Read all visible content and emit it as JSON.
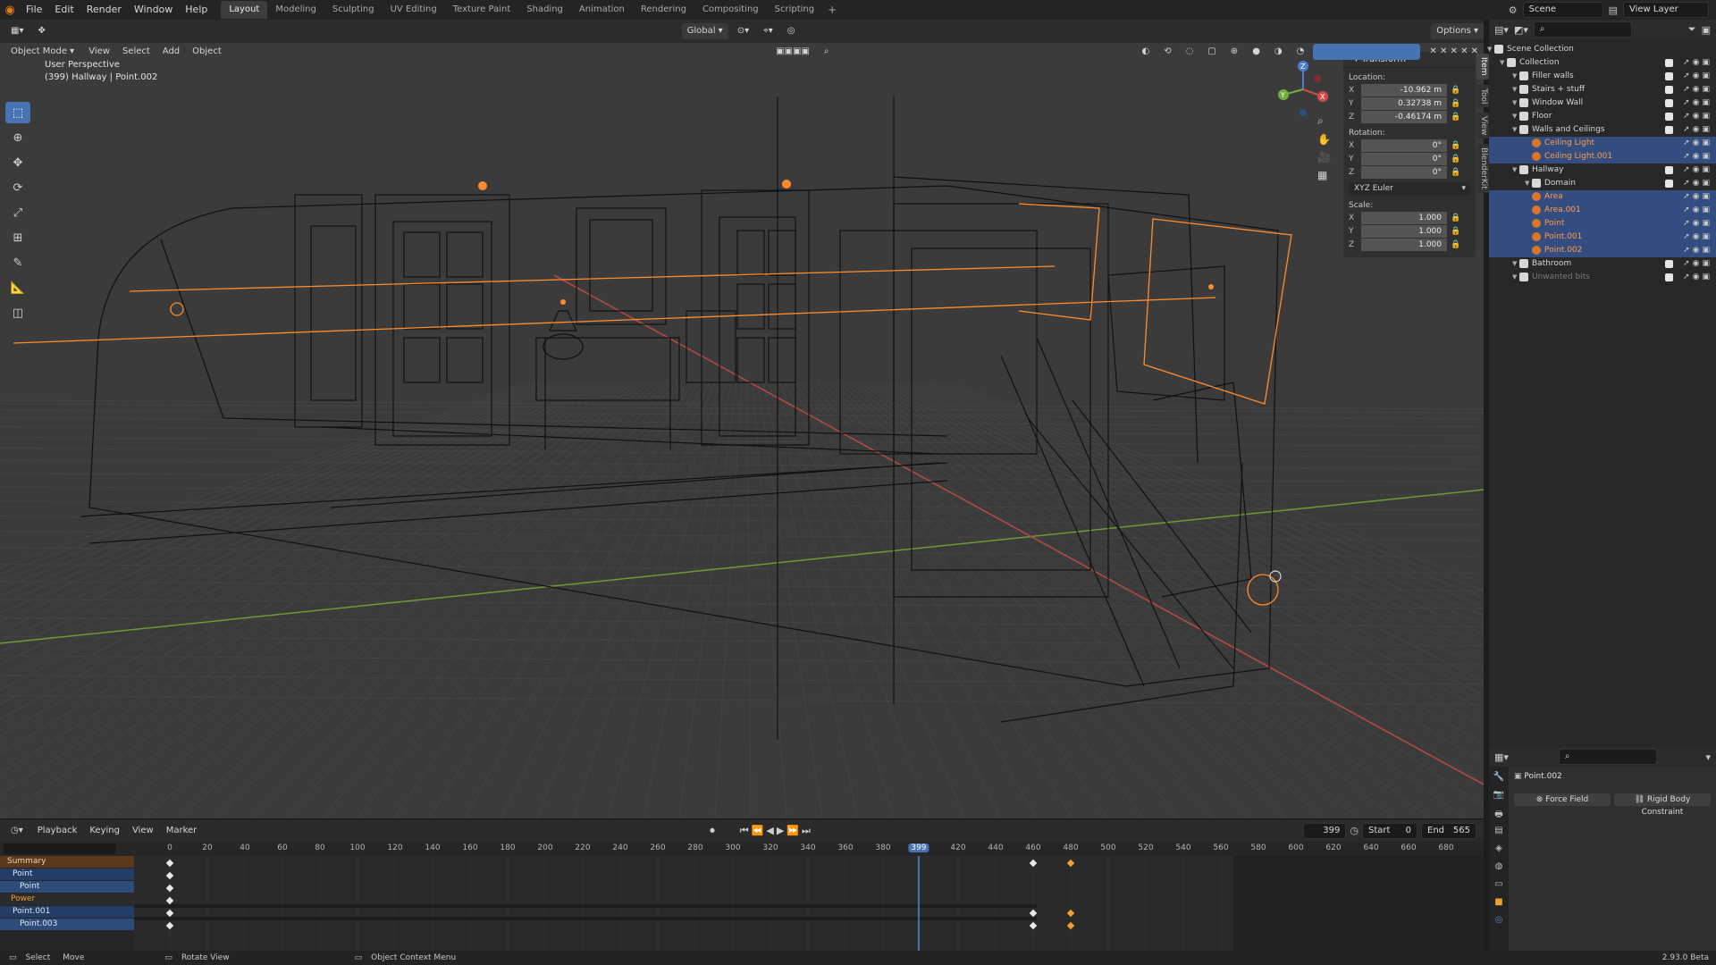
{
  "topbar": {
    "menus": [
      "File",
      "Edit",
      "Render",
      "Window",
      "Help"
    ],
    "workspaces": [
      "Layout",
      "Modeling",
      "Sculpting",
      "UV Editing",
      "Texture Paint",
      "Shading",
      "Animation",
      "Rendering",
      "Compositing",
      "Scripting"
    ],
    "active_workspace": "Layout",
    "add_tab": "+",
    "scene": "Scene",
    "view_layer": "View Layer"
  },
  "viewport": {
    "mode": "Object Mode",
    "menus": [
      "View",
      "Select",
      "Add",
      "Object"
    ],
    "orientation": "Global",
    "options": "Options",
    "perspective": "User Perspective",
    "object_info": "(399) Hallway | Point.002",
    "tools": [
      "select-box",
      "cursor",
      "move",
      "rotate",
      "scale",
      "transform",
      "annotate",
      "measure",
      "add-cube"
    ],
    "gizmo_axes": [
      "X",
      "Y",
      "Z"
    ]
  },
  "npanel": {
    "title": "Transform",
    "location_label": "Location:",
    "location": {
      "x": "-10.962 m",
      "y": "0.32738 m",
      "z": "-0.46174 m"
    },
    "rotation_label": "Rotation:",
    "rotation": {
      "x": "0°",
      "y": "0°",
      "z": "0°"
    },
    "euler_mode": "XYZ Euler",
    "scale_label": "Scale:",
    "scale": {
      "x": "1.000",
      "y": "1.000",
      "z": "1.000"
    },
    "side_tabs": [
      "Item",
      "Tool",
      "View",
      "BlenderKit"
    ]
  },
  "outliner": {
    "rows": [
      {
        "label": "Scene Collection",
        "depth": 0,
        "selected": false,
        "kind": "scene",
        "faded": false
      },
      {
        "label": "Collection",
        "depth": 1,
        "selected": false,
        "kind": "collection",
        "faded": false
      },
      {
        "label": "Filler walls",
        "depth": 2,
        "selected": false,
        "kind": "collection",
        "faded": false
      },
      {
        "label": "Stairs + stuff",
        "depth": 2,
        "selected": false,
        "kind": "collection",
        "faded": false
      },
      {
        "label": "Window Wall",
        "depth": 2,
        "selected": false,
        "kind": "collection",
        "faded": false
      },
      {
        "label": "Floor",
        "depth": 2,
        "selected": false,
        "kind": "collection",
        "faded": false
      },
      {
        "label": "Walls and Ceilings",
        "depth": 2,
        "selected": false,
        "kind": "collection",
        "faded": false
      },
      {
        "label": "Ceiling Light",
        "depth": 3,
        "selected": true,
        "kind": "light",
        "faded": false
      },
      {
        "label": "Ceiling Light.001",
        "depth": 3,
        "selected": true,
        "kind": "light",
        "faded": false
      },
      {
        "label": "Hallway",
        "depth": 2,
        "selected": false,
        "kind": "collection",
        "faded": false
      },
      {
        "label": "Domain",
        "depth": 3,
        "selected": false,
        "kind": "collection",
        "faded": false
      },
      {
        "label": "Area",
        "depth": 3,
        "selected": true,
        "kind": "light",
        "faded": false
      },
      {
        "label": "Area.001",
        "depth": 3,
        "selected": true,
        "kind": "light",
        "faded": false
      },
      {
        "label": "Point",
        "depth": 3,
        "selected": true,
        "kind": "light",
        "faded": false
      },
      {
        "label": "Point.001",
        "depth": 3,
        "selected": true,
        "kind": "light",
        "faded": false
      },
      {
        "label": "Point.002",
        "depth": 3,
        "selected": true,
        "kind": "light",
        "faded": false
      },
      {
        "label": "Bathroom",
        "depth": 2,
        "selected": false,
        "kind": "collection",
        "faded": false
      },
      {
        "label": "Unwanted bits",
        "depth": 2,
        "selected": false,
        "kind": "collection",
        "faded": true
      }
    ]
  },
  "properties": {
    "object": "Point.002",
    "buttons": [
      "Force Field",
      "Rigid Body Constraint"
    ]
  },
  "timeline": {
    "menus": [
      "Playback",
      "Keying",
      "View",
      "Marker"
    ],
    "current_frame": "399",
    "start_label": "Start",
    "start": "0",
    "end_label": "End",
    "end": "565",
    "ruler_ticks": [
      "0",
      "20",
      "40",
      "60",
      "80",
      "100",
      "120",
      "140",
      "160",
      "180",
      "200",
      "220",
      "240",
      "260",
      "280",
      "300",
      "320",
      "340",
      "360",
      "380",
      "399",
      "420",
      "440",
      "460",
      "480",
      "500",
      "520",
      "540",
      "560",
      "580",
      "600",
      "620",
      "640",
      "660",
      "680"
    ],
    "channels": [
      {
        "label": "Summary",
        "style": "summary"
      },
      {
        "label": "Point",
        "style": "object"
      },
      {
        "label": "Point",
        "style": "data"
      },
      {
        "label": "Power",
        "style": "fcurve"
      },
      {
        "label": "Point.001",
        "style": "object"
      },
      {
        "label": "Point.003",
        "style": "data"
      }
    ]
  },
  "status": {
    "items": [
      "Select",
      "Move",
      "Rotate View",
      "Object Context Menu"
    ],
    "version": "2.93.0 Beta"
  },
  "colors": {
    "accent": "#4772b3",
    "selection_orange": "#ff8c2a",
    "x_axis": "#b84a4a",
    "y_axis": "#6f9a33",
    "keyframe_selected": "#f0a030"
  }
}
